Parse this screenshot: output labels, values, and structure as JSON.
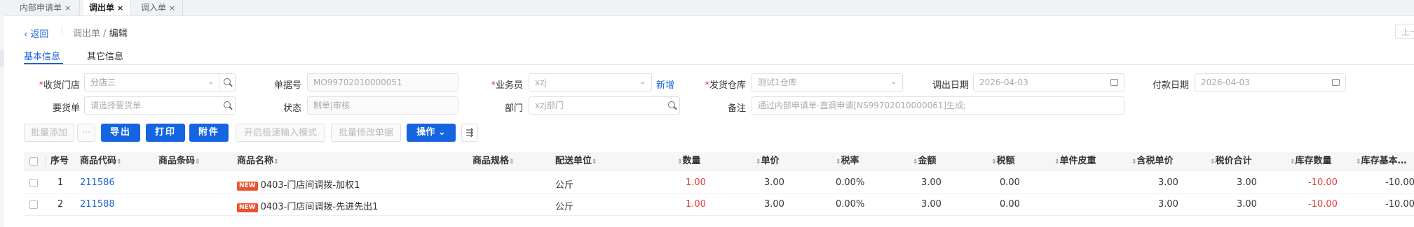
{
  "tabs": [
    {
      "label": "内部申请单",
      "active": false
    },
    {
      "label": "调出单",
      "active": true
    },
    {
      "label": "调入单",
      "active": false
    }
  ],
  "close_glyph": "×",
  "nav": {
    "back_label": "返回",
    "crumb_parent": "调出单",
    "crumb_sep": "/",
    "crumb_current": "编辑",
    "corner_button": "上一"
  },
  "subtabs": [
    "基本信息",
    "其它信息"
  ],
  "form": {
    "receive_store": {
      "label": "收货门店",
      "value": "分店三"
    },
    "doc_no": {
      "label": "单据号",
      "value": "MO99702010000051"
    },
    "salesman": {
      "label": "业务员",
      "value": "xzj",
      "new_link": "新增"
    },
    "ship_warehouse": {
      "label": "发货仓库",
      "placeholder": "测试1仓库"
    },
    "out_date": {
      "label": "调出日期",
      "value": "2026-04-03"
    },
    "pay_date": {
      "label": "付款日期",
      "value": "2026-04-03"
    },
    "request_doc": {
      "label": "要货单",
      "placeholder": "请选择要货单"
    },
    "status": {
      "label": "状态",
      "value": "制单|审核"
    },
    "dept": {
      "label": "部门",
      "value": "xzj部门"
    },
    "remark": {
      "label": "备注",
      "value": "通过内部申请单-直调申请[NS99702010000061]生成;"
    }
  },
  "toolbar": {
    "batch_add": "批量添加",
    "more": "···",
    "export": "导出",
    "print": "打印",
    "attach": "附件",
    "quick_input": "开启极速输入模式",
    "batch_edit": "批量修改单据",
    "operate": "操作",
    "columns_icon": "column-settings-icon"
  },
  "table": {
    "headers": [
      "序号",
      "商品代码",
      "商品条码",
      "商品名称",
      "商品规格",
      "配送单位",
      "数量",
      "单价",
      "税率",
      "金额",
      "税额",
      "单件皮重",
      "含税单价",
      "税价合计",
      "库存数量",
      "库存基本…"
    ],
    "new_badge": "NEW",
    "rows": [
      {
        "seq": "1",
        "code": "211586",
        "barcode": "",
        "name": "0403-门店间调拨-加权1",
        "spec": "",
        "unit": "公斤",
        "qty": "1.00",
        "price": "3.00",
        "tax_rate": "0.00%",
        "amount": "3.00",
        "tax": "0.00",
        "tare": "",
        "tax_price": "3.00",
        "total": "3.00",
        "stock": "-10.00",
        "stock_base": "-10.00"
      },
      {
        "seq": "2",
        "code": "211588",
        "barcode": "",
        "name": "0403-门店间调拨-先进先出1",
        "spec": "",
        "unit": "公斤",
        "qty": "1.00",
        "price": "3.00",
        "tax_rate": "0.00%",
        "amount": "3.00",
        "tax": "0.00",
        "tare": "",
        "tax_price": "3.00",
        "total": "3.00",
        "stock": "-10.00",
        "stock_base": "-10.00"
      }
    ]
  }
}
